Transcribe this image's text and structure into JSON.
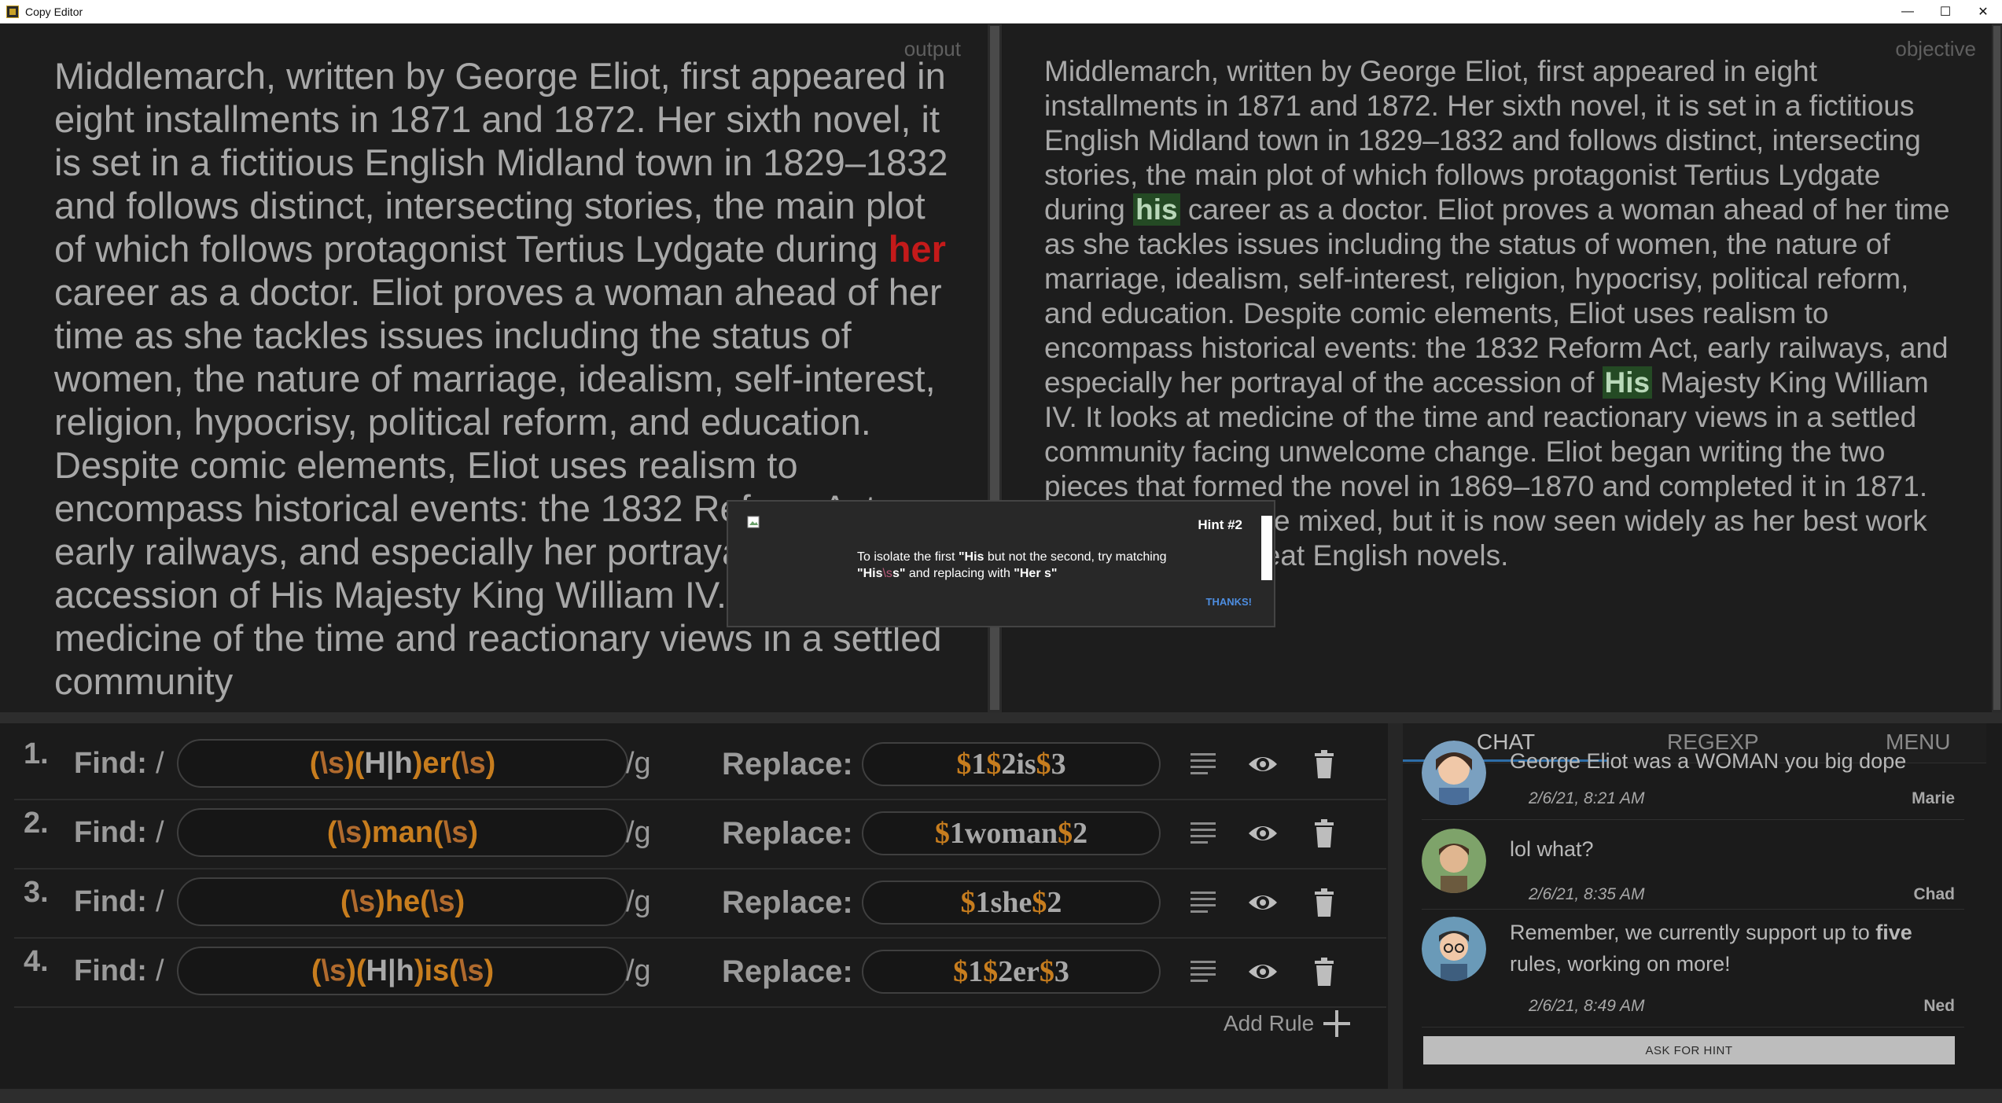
{
  "window": {
    "title": "Copy Editor",
    "controls": {
      "minimize": "—",
      "maximize": "☐",
      "close": "✕"
    }
  },
  "output": {
    "label": "output",
    "text_before": "Middlemarch, written by George Eliot, first appeared in eight installments in 1871 and 1872. Her sixth novel, it is set in a fictitious English Midland town in 1829–1832 and follows distinct, intersecting stories, the main plot of which follows protagonist Tertius Lydgate during ",
    "highlight": "her",
    "text_after": " career as a doctor. Eliot proves a woman ahead of her time as she tackles issues including the status of women, the nature of marriage, idealism, self-interest, religion, hypocrisy, political reform, and education. Despite comic elements, Eliot uses realism to encompass historical events: the 1832 Reform Act, early railways, and especially her portrayal of the accession of His Majesty King William IV. It looks at medicine of the time and reactionary views in a settled community"
  },
  "objective": {
    "label": "objective",
    "text_1": "Middlemarch, written by George Eliot, first appeared in eight installments in 1871 and 1872. Her sixth novel, it is set in a fictitious English Midland town in 1829–1832 and follows distinct, intersecting stories, the main plot of which follows protagonist Tertius Lydgate during ",
    "highlight_1": "his",
    "text_2": " career as a doctor. Eliot proves a woman ahead of her time as she tackles issues including the status of women, the nature of marriage, idealism, self-interest, religion, hypocrisy, political reform, and education. Despite comic elements, Eliot uses realism to encompass historical events: the 1832 Reform Act, early railways, and especially her portrayal of the accession of ",
    "highlight_2": "His",
    "text_3": " Majesty King William IV. It looks at medicine of the time and reactionary views in a settled community facing unwelcome change. Eliot began writing the two pieces that formed the novel in 1869–1870 and completed it in 1871. Initial reviews were mixed, but it is now seen widely as her best work and one of the great English novels."
  },
  "rules": {
    "find_label": "Find:",
    "slash": "/",
    "flag": "/g",
    "replace_label": "Replace:",
    "items": [
      {
        "num": "1.",
        "find": [
          "(",
          "\\s",
          ")(",
          "H",
          "|",
          "h",
          ")er(",
          "\\s",
          ")"
        ],
        "replace": [
          "$",
          "1",
          "$",
          "2is",
          "$",
          "3"
        ]
      },
      {
        "num": "2.",
        "find": [
          "(",
          "\\s",
          ")man(",
          "\\s",
          ")"
        ],
        "replace": [
          "$",
          "1woman",
          "$",
          "2"
        ]
      },
      {
        "num": "3.",
        "find": [
          "(",
          "\\s",
          ")he(",
          "\\s",
          ")"
        ],
        "replace": [
          "$",
          "1she",
          "$",
          "2"
        ]
      },
      {
        "num": "4.",
        "find": [
          "(",
          "\\s",
          ")(",
          "H",
          "|",
          "h",
          ")is(",
          "\\s",
          ")"
        ],
        "replace": [
          "$",
          "1",
          "$",
          "2er",
          "$",
          "3"
        ]
      }
    ],
    "add_rule_label": "Add Rule"
  },
  "chat": {
    "tabs": [
      "CHAT",
      "REGEXP",
      "MENU"
    ],
    "active_tab": "CHAT",
    "messages": [
      {
        "text": "George Eliot was a WOMAN you big dope",
        "time": "2/6/21, 8:21 AM",
        "author": "Marie"
      },
      {
        "text": "lol what?",
        "time": "2/6/21, 8:35 AM",
        "author": "Chad"
      },
      {
        "text_before": "Remember, we currently support up to ",
        "text_bold": "five",
        "text_after": " rules, working on more!",
        "time": "2/6/21, 8:49 AM",
        "author": "Ned"
      }
    ],
    "hint_button": "ASK FOR HINT"
  },
  "hint": {
    "title": "Hint #2",
    "line1_a": "To isolate the first ",
    "line1_b": "\"His",
    "line1_c": " but not the second, try matching",
    "line2_a": "\"His",
    "line2_b": "\\s",
    "line2_c": "s\"",
    "line2_d": " and replacing with ",
    "line2_e": "\"Her s\"",
    "thanks": "THANKS!"
  },
  "colors": {
    "background": "#1b1b1b",
    "text": "#a8a8a8",
    "error_red": "#c41a1a",
    "match_green": "#244a24",
    "regex_orange": "#c77d1e",
    "link_blue": "#4d8de0"
  }
}
